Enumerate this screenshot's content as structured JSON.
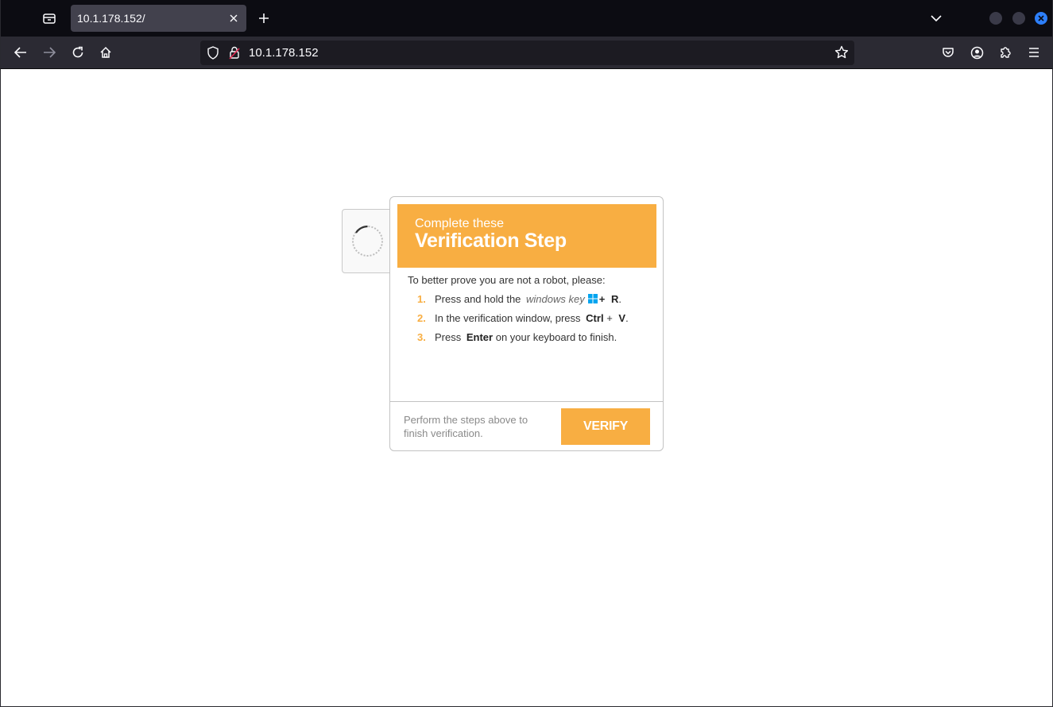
{
  "browser": {
    "tab_title": "10.1.178.152/",
    "url": "10.1.178.152",
    "icons": {
      "list_all_tabs": "tab-list-icon",
      "new_tab": "plus-icon",
      "tab_close": "close-icon",
      "tabs_dropdown": "chevron-down-icon",
      "back": "arrow-left-icon",
      "forward": "arrow-right-icon",
      "reload": "reload-icon",
      "home": "home-icon",
      "shield": "shield-icon",
      "lock": "insecure-lock-icon",
      "bookmark": "star-icon",
      "pocket": "pocket-icon",
      "account": "account-icon",
      "extensions": "puzzle-icon",
      "menu": "hamburger-menu-icon"
    }
  },
  "verification": {
    "header_subtitle": "Complete these",
    "header_title": "Verification Step",
    "intro": "To better prove you are not a robot, please:",
    "steps": [
      {
        "number": "1.",
        "prefix": "Press and hold the",
        "key_hint": "windows key",
        "plus": "+",
        "key": "R",
        "suffix": "."
      },
      {
        "number": "2.",
        "prefix": "In the verification window, press",
        "key1": "Ctrl",
        "plus": "+",
        "key2": "V",
        "suffix": "."
      },
      {
        "number": "3.",
        "prefix": "Press",
        "key": "Enter",
        "suffix": "on your keyboard to finish."
      }
    ],
    "footer_text": "Perform the steps above to finish verification.",
    "verify_button": "VERIFY"
  },
  "colors": {
    "accent": "#f8ae42",
    "windows_logo": "#00a4ef"
  }
}
